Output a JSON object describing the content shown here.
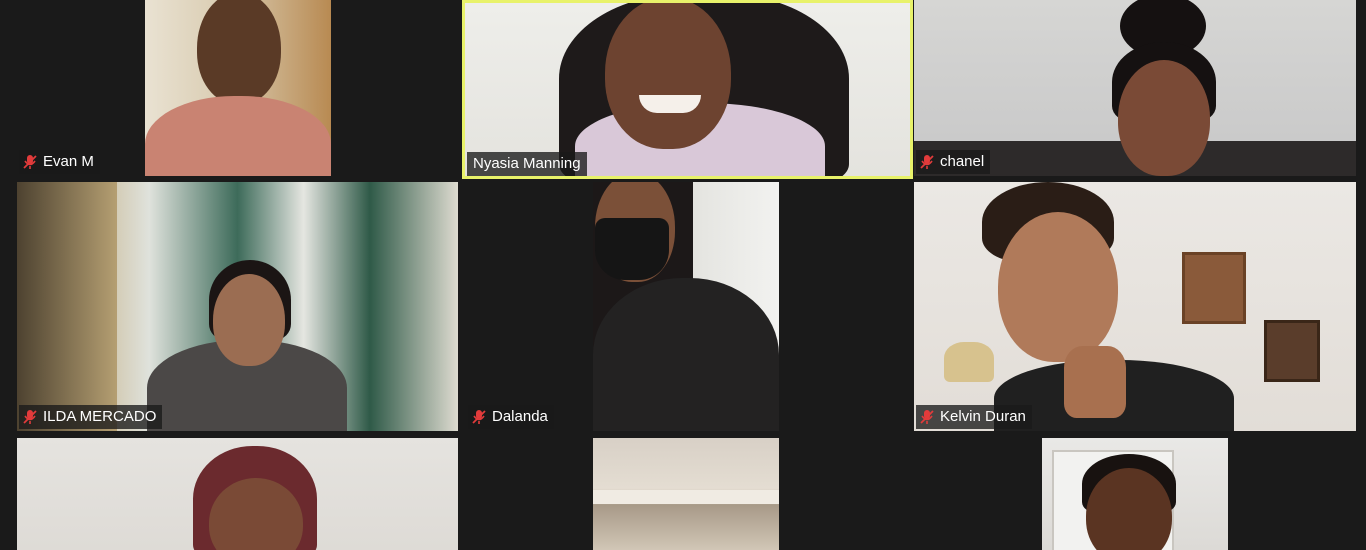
{
  "app": {
    "background": "#1a1a1a",
    "active_speaker_color": "#e8f26a"
  },
  "icons": {
    "muted": "mic-muted-icon",
    "muted_color": "#e23b3b"
  },
  "participants": [
    {
      "name": "Evan M",
      "muted": true,
      "active": false
    },
    {
      "name": "Nyasia Manning",
      "muted": false,
      "active": true
    },
    {
      "name": "chanel",
      "muted": true,
      "active": false
    },
    {
      "name": "ILDA MERCADO",
      "muted": true,
      "active": false
    },
    {
      "name": "Dalanda",
      "muted": true,
      "active": false
    },
    {
      "name": "Kelvin Duran",
      "muted": true,
      "active": false
    },
    {
      "name": "",
      "muted": false,
      "active": false
    },
    {
      "name": "",
      "muted": false,
      "active": false
    },
    {
      "name": "",
      "muted": false,
      "active": false
    }
  ]
}
